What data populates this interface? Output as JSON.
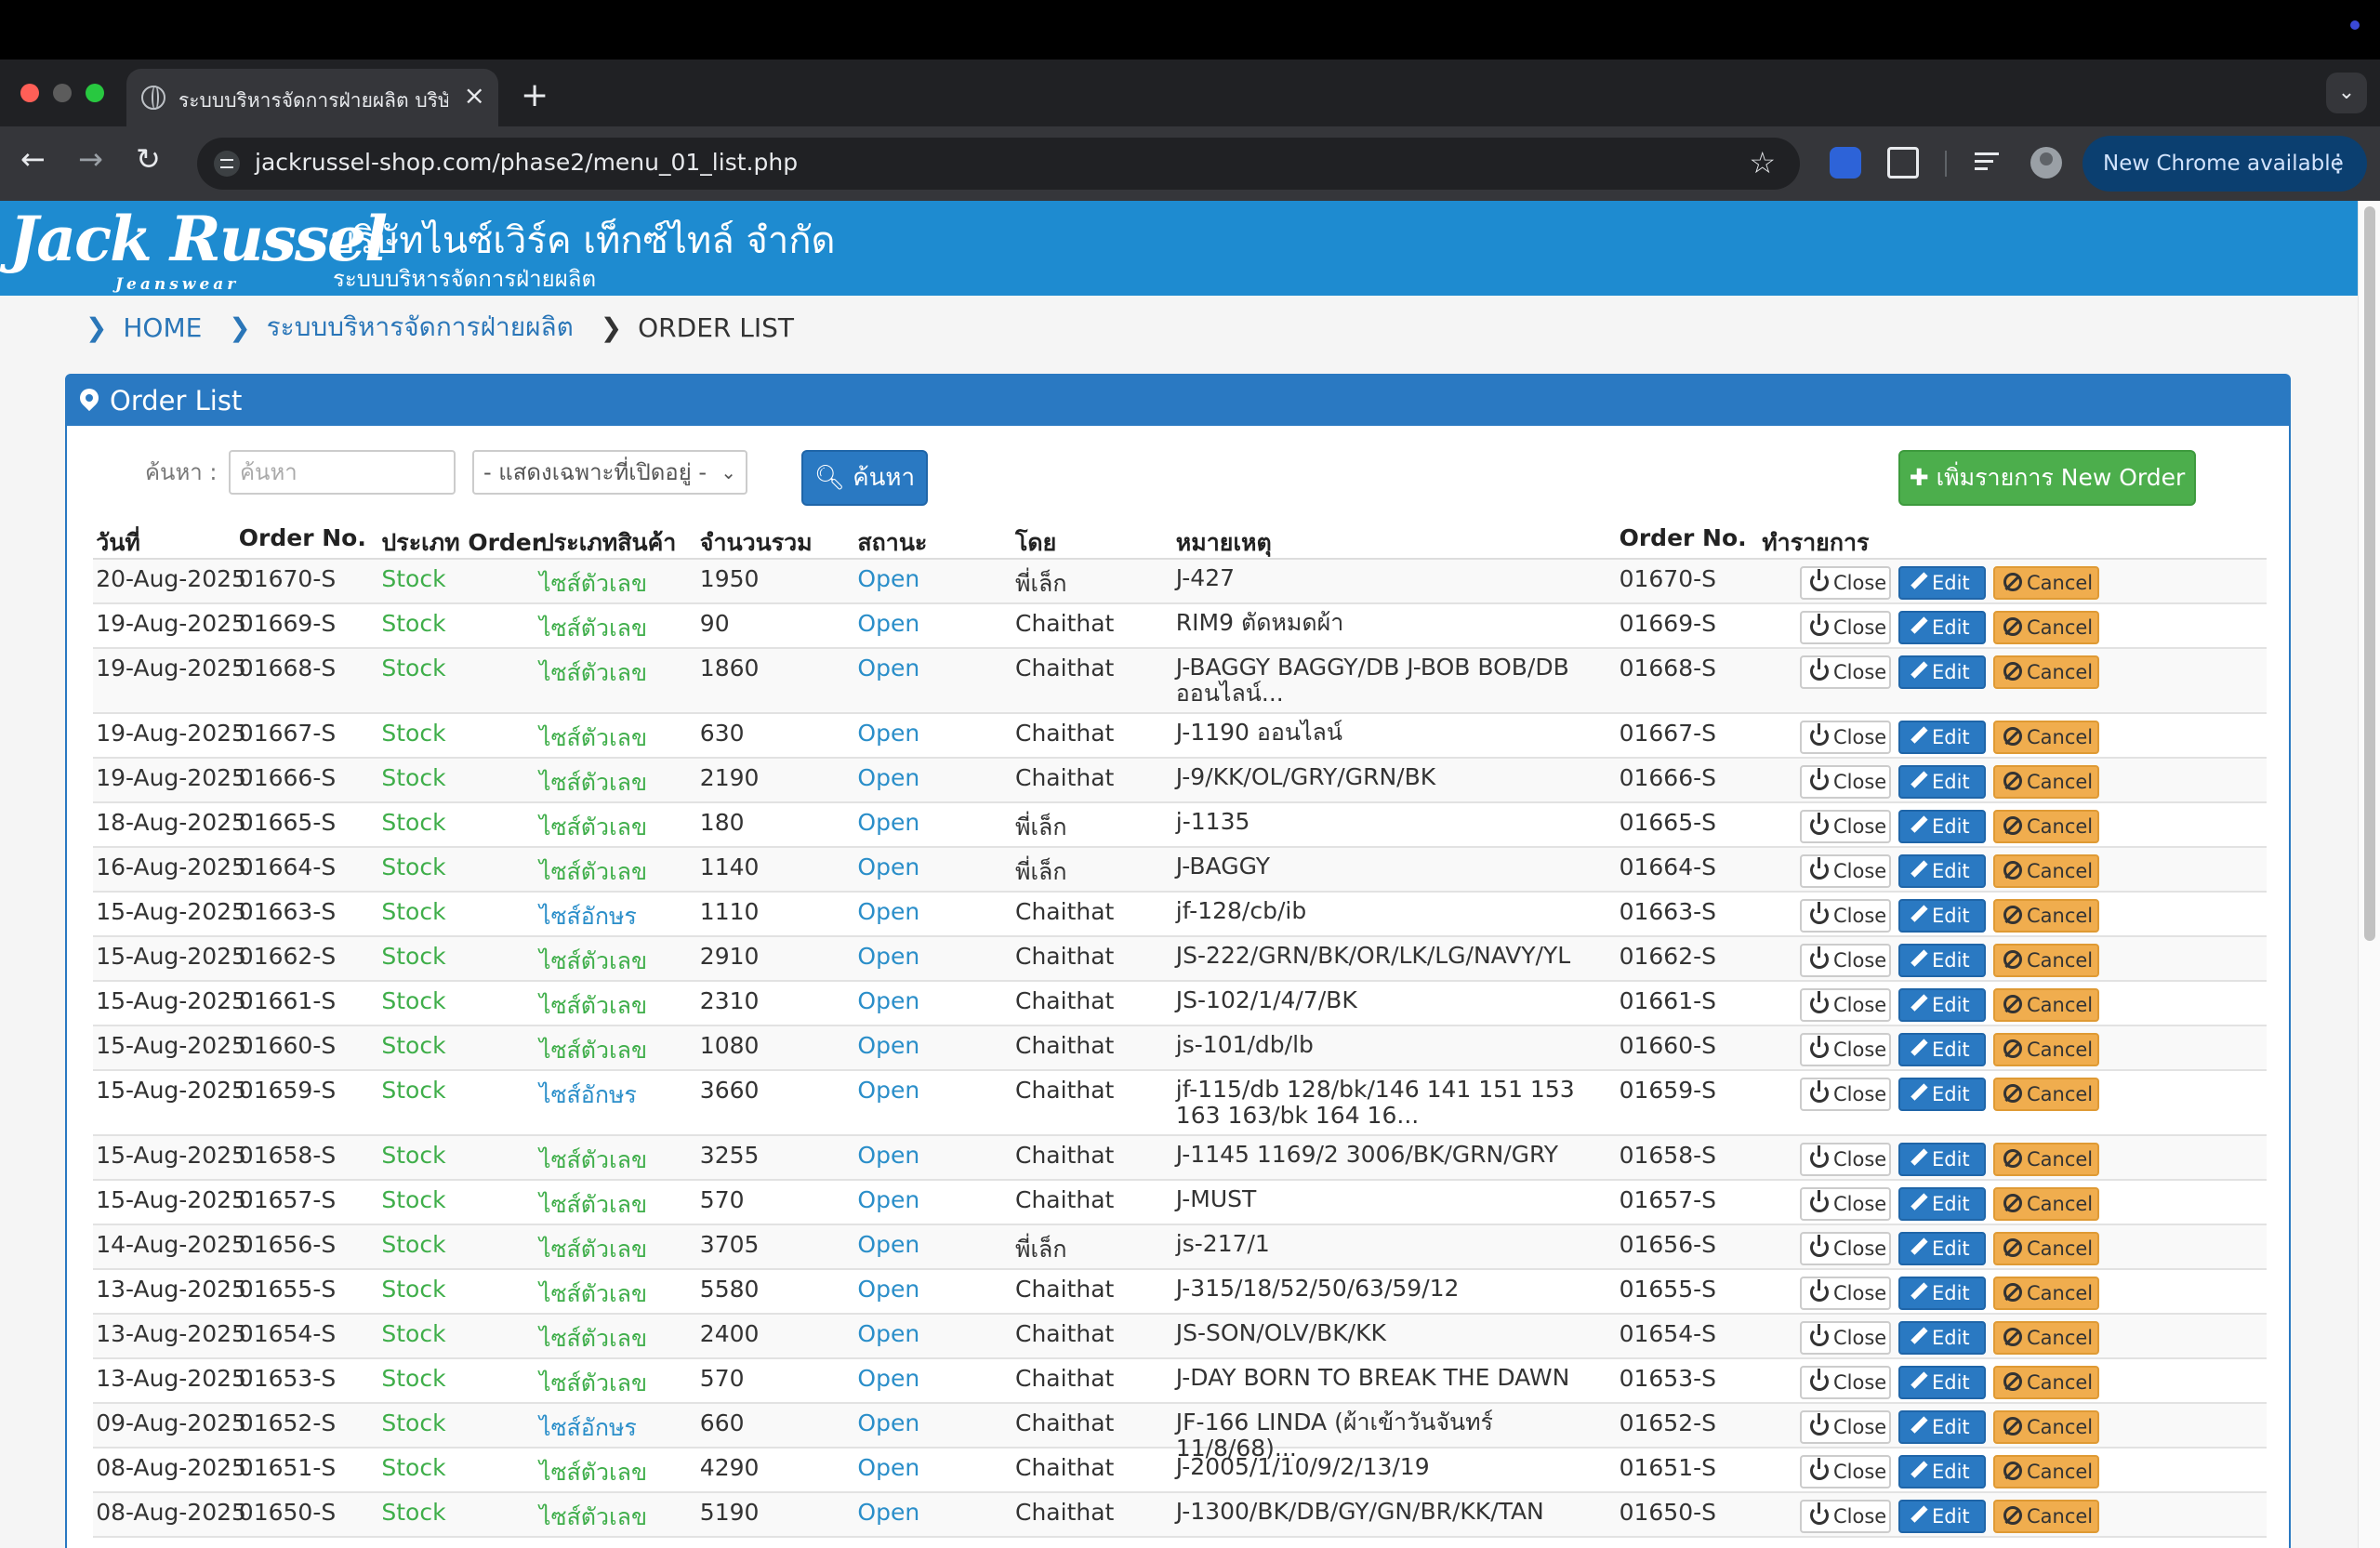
{
  "browser": {
    "tab_title": "ระบบบริหารจัดการฝ่ายผลิต บริษัท",
    "url": "jackrussel-shop.com/phase2/menu_01_list.php",
    "new_chrome_label": "New Chrome available"
  },
  "site": {
    "logo_text": "Jack Russel",
    "logo_sub": "Jeanswear",
    "company_name": "บริษัทไนซ์เวิร์ค เท็กซ์ไทล์ จำกัด",
    "system_name": "ระบบบริหารจัดการฝ่ายผลิต",
    "brand_color": "#1e8bd0"
  },
  "breadcrumb": {
    "home": "HOME",
    "section": "ระบบบริหารจัดการฝ่ายผลิต",
    "current": "ORDER LIST"
  },
  "panel": {
    "title": "Order List",
    "search_label": "ค้นหา :",
    "search_placeholder": "ค้นหา",
    "filter_selected": "- แสดงเฉพาะที่เปิดอยู่ -",
    "search_button": "ค้นหา",
    "new_order_button": "เพิ่มรายการ New Order"
  },
  "table": {
    "headers": [
      "วันที่",
      "Order No.",
      "ประเภท Order",
      "ประเภทสินค้า",
      "จำนวนรวม",
      "สถานะ",
      "โดย",
      "หมายเหตุ",
      "Order No.",
      "ทำรายการ"
    ],
    "action_labels": {
      "close": "Close",
      "edit": "Edit",
      "cancel": "Cancel"
    },
    "rows": [
      {
        "date": "20-Aug-2025",
        "order": "01670-S",
        "otype": "Stock",
        "ptype": "ไซส์ตัวเลข",
        "qty": "1950",
        "status": "Open",
        "by": "พี่เล็ก",
        "note": "J-427",
        "order2": "01670-S"
      },
      {
        "date": "19-Aug-2025",
        "order": "01669-S",
        "otype": "Stock",
        "ptype": "ไซส์ตัวเลข",
        "qty": "90",
        "status": "Open",
        "by": "Chaithat",
        "note": "RIM9 ตัดหมดผ้า",
        "order2": "01669-S"
      },
      {
        "date": "19-Aug-2025",
        "order": "01668-S",
        "otype": "Stock",
        "ptype": "ไซส์ตัวเลข",
        "qty": "1860",
        "status": "Open",
        "by": "Chaithat",
        "note": "J-BAGGY BAGGY/DB J-BOB BOB/DB ออนไลน์...",
        "order2": "01668-S"
      },
      {
        "date": "19-Aug-2025",
        "order": "01667-S",
        "otype": "Stock",
        "ptype": "ไซส์ตัวเลข",
        "qty": "630",
        "status": "Open",
        "by": "Chaithat",
        "note": "J-1190 ออนไลน์",
        "order2": "01667-S"
      },
      {
        "date": "19-Aug-2025",
        "order": "01666-S",
        "otype": "Stock",
        "ptype": "ไซส์ตัวเลข",
        "qty": "2190",
        "status": "Open",
        "by": "Chaithat",
        "note": "J-9/KK/OL/GRY/GRN/BK",
        "order2": "01666-S"
      },
      {
        "date": "18-Aug-2025",
        "order": "01665-S",
        "otype": "Stock",
        "ptype": "ไซส์ตัวเลข",
        "qty": "180",
        "status": "Open",
        "by": "พี่เล็ก",
        "note": "j-1135",
        "order2": "01665-S"
      },
      {
        "date": "16-Aug-2025",
        "order": "01664-S",
        "otype": "Stock",
        "ptype": "ไซส์ตัวเลข",
        "qty": "1140",
        "status": "Open",
        "by": "พี่เล็ก",
        "note": "J-BAGGY",
        "order2": "01664-S"
      },
      {
        "date": "15-Aug-2025",
        "order": "01663-S",
        "otype": "Stock",
        "ptype": "ไซส์อักษร",
        "qty": "1110",
        "status": "Open",
        "by": "Chaithat",
        "note": "jf-128/cb/ib",
        "order2": "01663-S"
      },
      {
        "date": "15-Aug-2025",
        "order": "01662-S",
        "otype": "Stock",
        "ptype": "ไซส์ตัวเลข",
        "qty": "2910",
        "status": "Open",
        "by": "Chaithat",
        "note": "JS-222/GRN/BK/OR/LK/LG/NAVY/YL",
        "order2": "01662-S"
      },
      {
        "date": "15-Aug-2025",
        "order": "01661-S",
        "otype": "Stock",
        "ptype": "ไซส์ตัวเลข",
        "qty": "2310",
        "status": "Open",
        "by": "Chaithat",
        "note": "JS-102/1/4/7/BK",
        "order2": "01661-S"
      },
      {
        "date": "15-Aug-2025",
        "order": "01660-S",
        "otype": "Stock",
        "ptype": "ไซส์ตัวเลข",
        "qty": "1080",
        "status": "Open",
        "by": "Chaithat",
        "note": "js-101/db/lb",
        "order2": "01660-S"
      },
      {
        "date": "15-Aug-2025",
        "order": "01659-S",
        "otype": "Stock",
        "ptype": "ไซส์อักษร",
        "qty": "3660",
        "status": "Open",
        "by": "Chaithat",
        "note": "jf-115/db 128/bk/146 141 151 153 163 163/bk 164 16...",
        "order2": "01659-S"
      },
      {
        "date": "15-Aug-2025",
        "order": "01658-S",
        "otype": "Stock",
        "ptype": "ไซส์ตัวเลข",
        "qty": "3255",
        "status": "Open",
        "by": "Chaithat",
        "note": "J-1145 1169/2 3006/BK/GRN/GRY",
        "order2": "01658-S"
      },
      {
        "date": "15-Aug-2025",
        "order": "01657-S",
        "otype": "Stock",
        "ptype": "ไซส์ตัวเลข",
        "qty": "570",
        "status": "Open",
        "by": "Chaithat",
        "note": "J-MUST",
        "order2": "01657-S"
      },
      {
        "date": "14-Aug-2025",
        "order": "01656-S",
        "otype": "Stock",
        "ptype": "ไซส์ตัวเลข",
        "qty": "3705",
        "status": "Open",
        "by": "พี่เล็ก",
        "note": "js-217/1",
        "order2": "01656-S"
      },
      {
        "date": "13-Aug-2025",
        "order": "01655-S",
        "otype": "Stock",
        "ptype": "ไซส์ตัวเลข",
        "qty": "5580",
        "status": "Open",
        "by": "Chaithat",
        "note": "J-315/18/52/50/63/59/12",
        "order2": "01655-S"
      },
      {
        "date": "13-Aug-2025",
        "order": "01654-S",
        "otype": "Stock",
        "ptype": "ไซส์ตัวเลข",
        "qty": "2400",
        "status": "Open",
        "by": "Chaithat",
        "note": "JS-SON/OLV/BK/KK",
        "order2": "01654-S"
      },
      {
        "date": "13-Aug-2025",
        "order": "01653-S",
        "otype": "Stock",
        "ptype": "ไซส์ตัวเลข",
        "qty": "570",
        "status": "Open",
        "by": "Chaithat",
        "note": "J-DAY BORN TO BREAK THE DAWN",
        "order2": "01653-S"
      },
      {
        "date": "09-Aug-2025",
        "order": "01652-S",
        "otype": "Stock",
        "ptype": "ไซส์อักษร",
        "qty": "660",
        "status": "Open",
        "by": "Chaithat",
        "note": "JF-166 LINDA (ผ้าเข้าวันจันทร์ 11/8/68)...",
        "order2": "01652-S"
      },
      {
        "date": "08-Aug-2025",
        "order": "01651-S",
        "otype": "Stock",
        "ptype": "ไซส์ตัวเลข",
        "qty": "4290",
        "status": "Open",
        "by": "Chaithat",
        "note": "J-2005/1/10/9/2/13/19",
        "order2": "01651-S"
      },
      {
        "date": "08-Aug-2025",
        "order": "01650-S",
        "otype": "Stock",
        "ptype": "ไซส์ตัวเลข",
        "qty": "5190",
        "status": "Open",
        "by": "Chaithat",
        "note": "J-1300/BK/DB/GY/GN/BR/KK/TAN",
        "order2": "01650-S"
      }
    ]
  }
}
